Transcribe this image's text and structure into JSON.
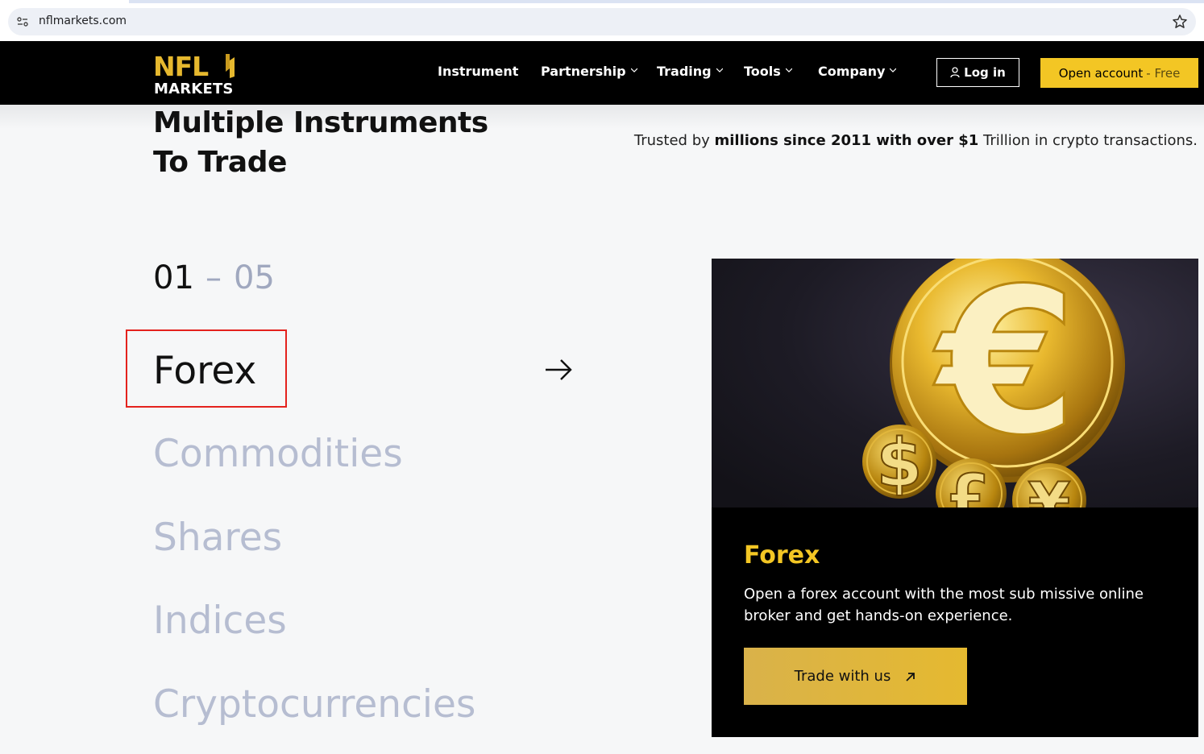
{
  "browser": {
    "url": "nflmarkets.com"
  },
  "header": {
    "logo_top": "NFL",
    "logo_bottom": "MARKETS",
    "nav": [
      {
        "label": "Instrument",
        "dropdown": false
      },
      {
        "label": "Partnership",
        "dropdown": true
      },
      {
        "label": "Trading",
        "dropdown": true
      },
      {
        "label": "Tools",
        "dropdown": true
      },
      {
        "label": "Company",
        "dropdown": true
      }
    ],
    "login_label": "Log in",
    "open_account_label": "Open account",
    "open_account_suffix": "- Free"
  },
  "hero": {
    "title_line1": "Multiple Instruments",
    "title_line2": "To Trade",
    "trust_prefix": "Trusted by ",
    "trust_bold": "millions since 2011 with over $1",
    "trust_suffix": " Trillion in crypto transactions."
  },
  "counter": {
    "current": "01",
    "dash": "–",
    "total": "05"
  },
  "categories": [
    {
      "label": "Forex",
      "active": true
    },
    {
      "label": "Commodities",
      "active": false
    },
    {
      "label": "Shares",
      "active": false
    },
    {
      "label": "Indices",
      "active": false
    },
    {
      "label": "Cryptocurrencies",
      "active": false
    }
  ],
  "card": {
    "title": "Forex",
    "description": "Open a forex account with the most sub missive online broker and get hands-on experience.",
    "button_label": "Trade with us",
    "coin_symbols": [
      "€",
      "$",
      "£",
      "¥"
    ]
  },
  "colors": {
    "brand_gold": "#f3c624",
    "header_bg": "#000000",
    "inactive_category": "#b6bdd1",
    "highlight": "#e4221d"
  }
}
